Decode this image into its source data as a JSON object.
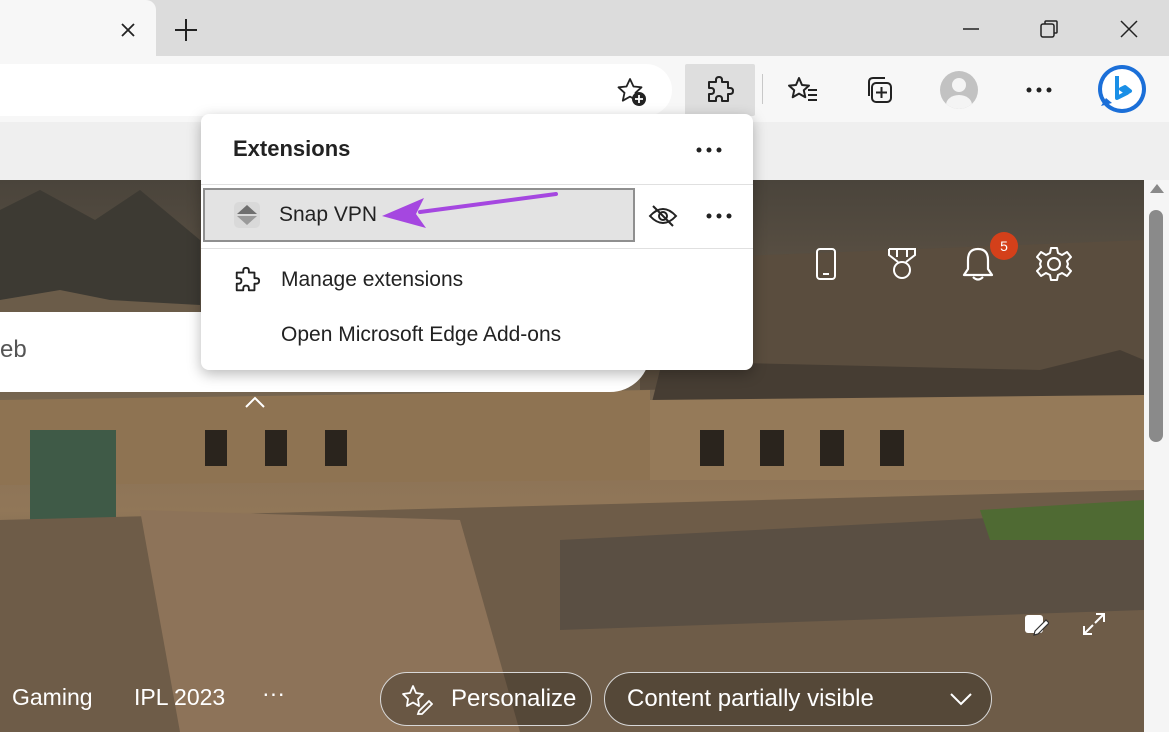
{
  "colors": {
    "accent": "#a547e0",
    "badge": "#d4401a",
    "titlebar": "#dcdcdc",
    "toolbar": "#f7f7f7"
  },
  "titlebar": {
    "tab_close_icon": "close-icon",
    "new_tab_icon": "plus-icon",
    "window_controls": [
      "minimize-icon",
      "restore-icon",
      "close-icon"
    ]
  },
  "toolbar": {
    "add_favorite_icon": "star-plus-icon",
    "buttons": [
      "extensions-icon",
      "favorites-icon",
      "collections-icon",
      "profile-avatar",
      "more-icon",
      "bing-chat-icon"
    ]
  },
  "search": {
    "visible_text": "eb"
  },
  "hero": {
    "icons": [
      "phone-icon",
      "rewards-medal-icon",
      "bell-icon",
      "gear-icon"
    ],
    "notification_count": "5",
    "bottom_links": [
      "Gaming",
      "IPL 2023",
      "···"
    ],
    "personalize_label": "Personalize",
    "content_visibility_label": "Content partially visible"
  },
  "extensions_popup": {
    "title": "Extensions",
    "extension": {
      "name": "Snap VPN"
    },
    "menu": [
      {
        "label": "Manage extensions",
        "icon": "puzzle-icon"
      },
      {
        "label": "Open Microsoft Edge Add-ons",
        "icon": ""
      }
    ]
  }
}
